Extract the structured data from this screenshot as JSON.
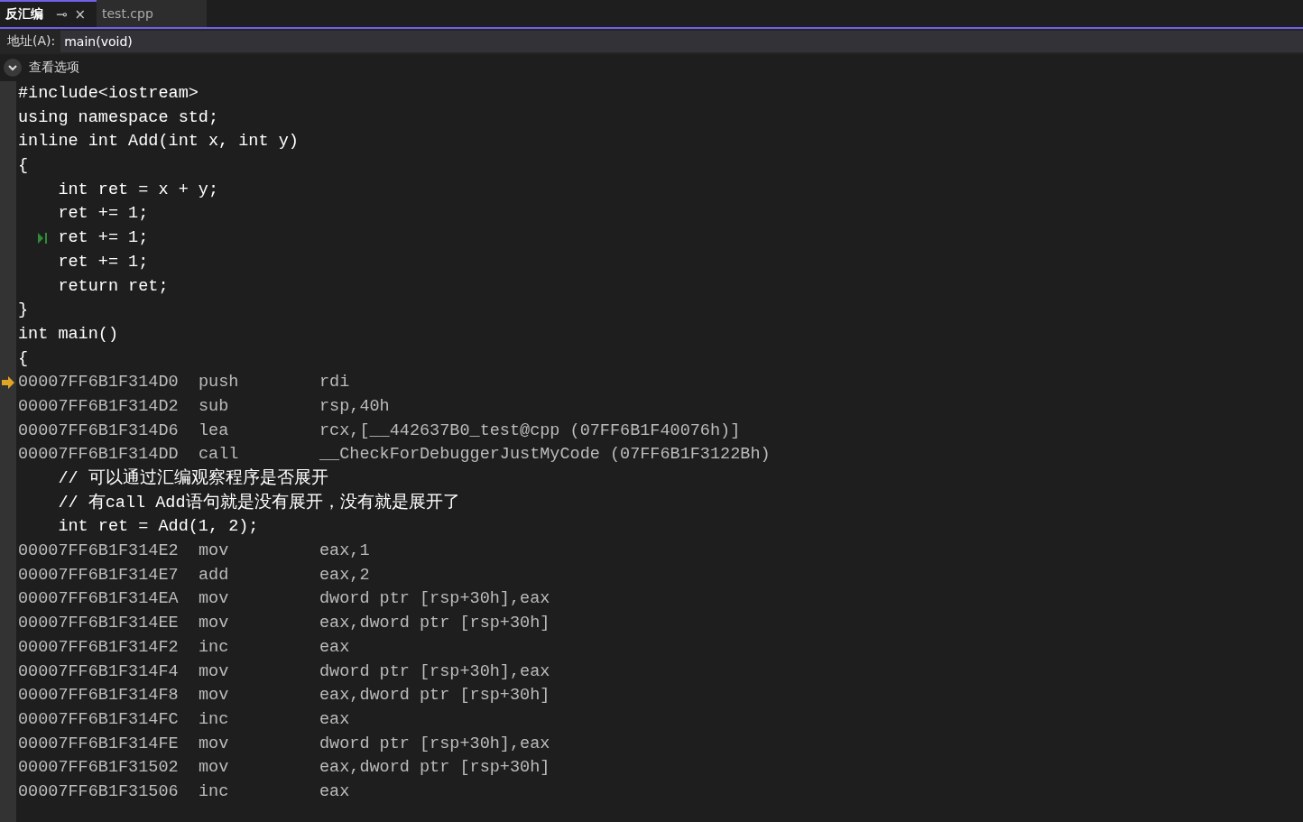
{
  "tabs": [
    {
      "label": "反汇编",
      "selected": true,
      "pin": "⊸",
      "close": "×"
    },
    {
      "label": "test.cpp",
      "selected": false
    }
  ],
  "address_bar": {
    "label": "地址(A):",
    "value": "main(void)"
  },
  "view_options": {
    "label": "查看选项",
    "expanded": false
  },
  "lines": [
    {
      "kind": "source",
      "text": "#include<iostream>",
      "current": false,
      "step": false
    },
    {
      "kind": "source",
      "text": "using namespace std;",
      "current": false,
      "step": false
    },
    {
      "kind": "source",
      "text": "inline int Add(int x, int y)",
      "current": false,
      "step": false
    },
    {
      "kind": "source",
      "text": "{",
      "current": false,
      "step": false
    },
    {
      "kind": "source",
      "text": "    int ret = x + y;",
      "current": false,
      "step": false
    },
    {
      "kind": "source",
      "text": "    ret += 1;",
      "current": false,
      "step": false
    },
    {
      "kind": "source",
      "text": "    ret += 1;",
      "current": false,
      "step": true
    },
    {
      "kind": "source",
      "text": "    ret += 1;",
      "current": false,
      "step": false
    },
    {
      "kind": "source",
      "text": "    return ret;",
      "current": false,
      "step": false
    },
    {
      "kind": "source",
      "text": "}",
      "current": false,
      "step": false
    },
    {
      "kind": "source",
      "text": "int main()",
      "current": false,
      "step": false
    },
    {
      "kind": "source",
      "text": "{",
      "current": false,
      "step": false
    },
    {
      "kind": "asm",
      "address": "00007FF6B1F314D0",
      "mnemonic": "push",
      "operands": "rdi",
      "current": true,
      "step": false
    },
    {
      "kind": "asm",
      "address": "00007FF6B1F314D2",
      "mnemonic": "sub",
      "operands": "rsp,40h",
      "current": false,
      "step": false
    },
    {
      "kind": "asm",
      "address": "00007FF6B1F314D6",
      "mnemonic": "lea",
      "operands": "rcx,[__442637B0_test@cpp (07FF6B1F40076h)]",
      "current": false,
      "step": false
    },
    {
      "kind": "asm",
      "address": "00007FF6B1F314DD",
      "mnemonic": "call",
      "operands": "__CheckForDebuggerJustMyCode (07FF6B1F3122Bh)",
      "current": false,
      "step": false
    },
    {
      "kind": "source",
      "text": "    // 可以通过汇编观察程序是否展开",
      "current": false,
      "step": false
    },
    {
      "kind": "source",
      "text": "    // 有call Add语句就是没有展开，没有就是展开了",
      "current": false,
      "step": false
    },
    {
      "kind": "source",
      "text": "    int ret = Add(1, 2);",
      "current": false,
      "step": false
    },
    {
      "kind": "asm",
      "address": "00007FF6B1F314E2",
      "mnemonic": "mov",
      "operands": "eax,1",
      "current": false,
      "step": false
    },
    {
      "kind": "asm",
      "address": "00007FF6B1F314E7",
      "mnemonic": "add",
      "operands": "eax,2",
      "current": false,
      "step": false
    },
    {
      "kind": "asm",
      "address": "00007FF6B1F314EA",
      "mnemonic": "mov",
      "operands": "dword ptr [rsp+30h],eax",
      "current": false,
      "step": false
    },
    {
      "kind": "asm",
      "address": "00007FF6B1F314EE",
      "mnemonic": "mov",
      "operands": "eax,dword ptr [rsp+30h]",
      "current": false,
      "step": false
    },
    {
      "kind": "asm",
      "address": "00007FF6B1F314F2",
      "mnemonic": "inc",
      "operands": "eax",
      "current": false,
      "step": false
    },
    {
      "kind": "asm",
      "address": "00007FF6B1F314F4",
      "mnemonic": "mov",
      "operands": "dword ptr [rsp+30h],eax",
      "current": false,
      "step": false
    },
    {
      "kind": "asm",
      "address": "00007FF6B1F314F8",
      "mnemonic": "mov",
      "operands": "eax,dword ptr [rsp+30h]",
      "current": false,
      "step": false
    },
    {
      "kind": "asm",
      "address": "00007FF6B1F314FC",
      "mnemonic": "inc",
      "operands": "eax",
      "current": false,
      "step": false
    },
    {
      "kind": "asm",
      "address": "00007FF6B1F314FE",
      "mnemonic": "mov",
      "operands": "dword ptr [rsp+30h],eax",
      "current": false,
      "step": false
    },
    {
      "kind": "asm",
      "address": "00007FF6B1F31502",
      "mnemonic": "mov",
      "operands": "eax,dword ptr [rsp+30h]",
      "current": false,
      "step": false
    },
    {
      "kind": "asm",
      "address": "00007FF6B1F31506",
      "mnemonic": "inc",
      "operands": "eax",
      "current": false,
      "step": false
    }
  ]
}
